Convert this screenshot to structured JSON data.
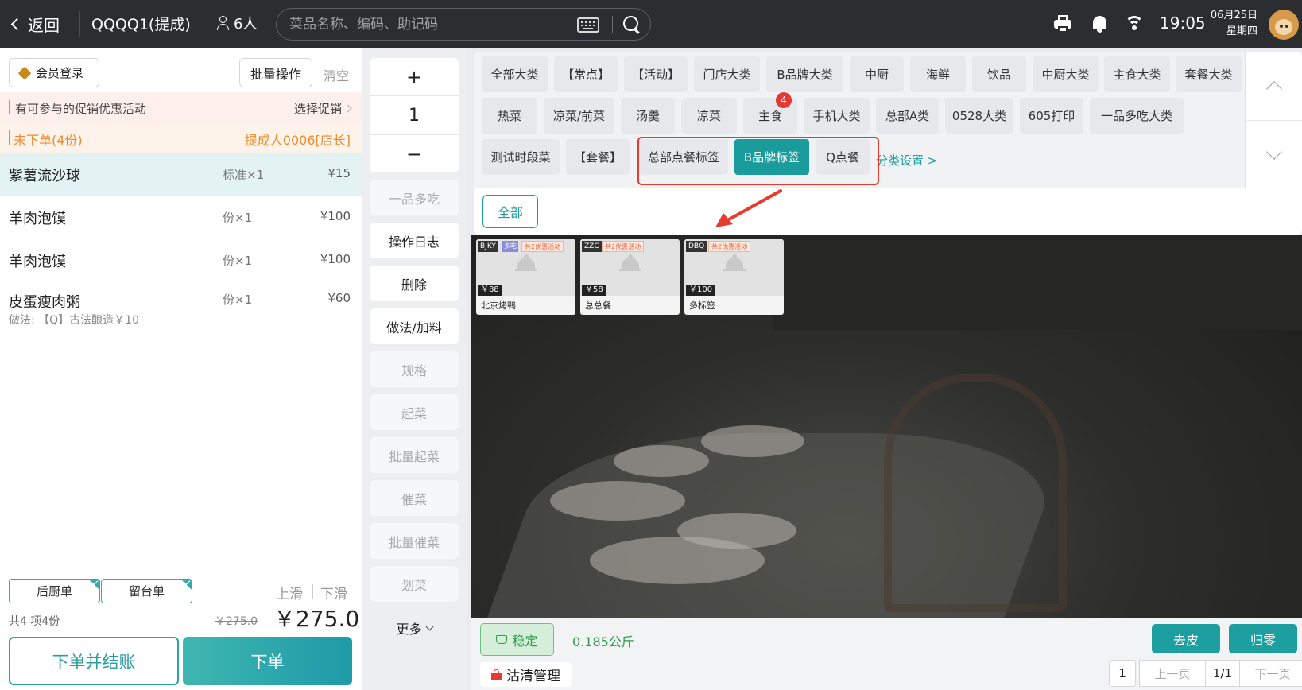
{
  "header": {
    "back_label": "返回",
    "table_name": "QQQQ1(提成)",
    "guests": "6人",
    "search_placeholder": "菜品名称、编码、助记码",
    "time": "19:05",
    "date": "06月25日",
    "weekday": "星期四"
  },
  "order": {
    "member_login": "会员登录",
    "batch_label": "批量操作",
    "clear_label": "清空",
    "promo_text": "有可参与的促销优惠活动",
    "promo_action": "选择促销",
    "status_text": "未下单(4份)",
    "staff_text": "提成人0006[店长]",
    "items": [
      {
        "name": "紫薯流沙球",
        "qty": "标准×1",
        "price": "¥15",
        "note": ""
      },
      {
        "name": "羊肉泡馍",
        "qty": "份×1",
        "price": "¥100",
        "note": ""
      },
      {
        "name": "羊肉泡馍",
        "qty": "份×1",
        "price": "¥100",
        "note": ""
      },
      {
        "name": "皮蛋瘦肉粥",
        "qty": "份×1",
        "price": "¥60",
        "note": "做法:  【Q】古法酿造￥10"
      }
    ],
    "tag_kitchen": "后厨单",
    "tag_counter": "留台单",
    "slide_up": "上滑",
    "slide_down": "下滑",
    "summary": "共4 项4份",
    "orig_total": "￥275.0",
    "total": "￥275.0",
    "checkout_label": "下单并结账",
    "submit_label": "下单"
  },
  "actions": {
    "plus": "+",
    "qty": "1",
    "minus": "−",
    "buttons": [
      {
        "label": "一品多吃",
        "enabled": false
      },
      {
        "label": "操作日志",
        "enabled": true
      },
      {
        "label": "删除",
        "enabled": true
      },
      {
        "label": "做法/加料",
        "enabled": true
      },
      {
        "label": "规格",
        "enabled": false
      },
      {
        "label": "起菜",
        "enabled": false
      },
      {
        "label": "批量起菜",
        "enabled": false
      },
      {
        "label": "催菜",
        "enabled": false
      },
      {
        "label": "批量催菜",
        "enabled": false
      },
      {
        "label": "划菜",
        "enabled": false
      }
    ],
    "more": "更多"
  },
  "categories": {
    "items": [
      "全部大类",
      "【常点】",
      "【活动】",
      "门店大类",
      "B品牌大类",
      "中厨",
      "海鲜",
      "饮品",
      "中厨大类",
      "主食大类",
      "套餐大类",
      "热菜",
      "凉菜/前菜",
      "汤羹",
      "凉菜",
      "主食",
      "手机大类",
      "总部A类",
      "0528大类",
      "605打印",
      "一品多吃大类",
      "测试时段菜",
      "【套餐】",
      "总部点餐标签",
      "B品牌标签",
      "Q点餐"
    ],
    "active": "B品牌标签",
    "badge_count": "4",
    "settings_link": "分类设置 >",
    "all_label": "全部"
  },
  "dishes": [
    {
      "code": "BJKY",
      "multi": "多吃",
      "promo": "共2优惠活动",
      "price": "￥88",
      "name": "北京烤鸭"
    },
    {
      "code": "ZZC",
      "multi": "",
      "promo": "共2优惠活动",
      "price": "￥58",
      "name": "总总餐"
    },
    {
      "code": "DBQ",
      "multi": "",
      "promo": "共2优惠活动",
      "price": "￥100",
      "name": "多标签"
    }
  ],
  "scale": {
    "status": "稳定",
    "weight": "0.185公斤",
    "tare": "去皮",
    "zero": "归零",
    "clean": "沽清管理"
  },
  "pagination": {
    "current": "1",
    "prev": "上一页",
    "total": "1/1",
    "next": "下一页"
  },
  "colors": {
    "accent": "#1a9c9c",
    "topbar": "#2b2d31",
    "warning": "#f08a2c",
    "highlight": "#e83a2e"
  }
}
